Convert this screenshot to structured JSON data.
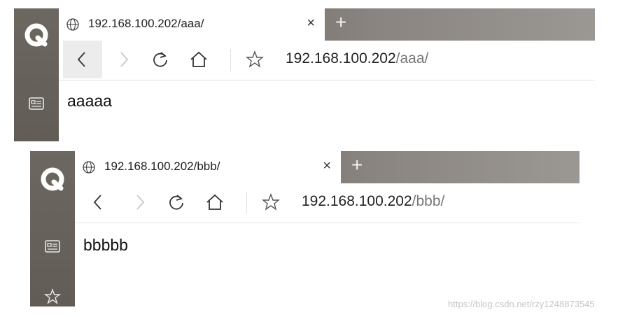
{
  "browsers": [
    {
      "tab": {
        "title": "192.168.100.202/aaa/",
        "close": "×",
        "new_tab": "+"
      },
      "address": {
        "host": "192.168.100.202",
        "path": "/aaa/"
      },
      "content": {
        "text": "aaaaa"
      }
    },
    {
      "tab": {
        "title": "192.168.100.202/bbb/",
        "close": "×",
        "new_tab": "+"
      },
      "address": {
        "host": "192.168.100.202",
        "path": "/bbb/"
      },
      "content": {
        "text": "bbbbb"
      }
    }
  ],
  "watermark": "https://blog.csdn.net/rzy1248873545",
  "colors": {
    "sidebar": "#67615b",
    "tabbar_gradient_end": "#9b9792",
    "url_path": "#777777"
  },
  "icons": [
    "browser-logo-icon",
    "globe-icon",
    "close-icon",
    "new-tab-icon",
    "back-arrow-icon",
    "forward-arrow-icon",
    "reload-icon",
    "home-icon",
    "bookmark-star-icon",
    "reader-card-icon",
    "favorites-star-icon"
  ]
}
